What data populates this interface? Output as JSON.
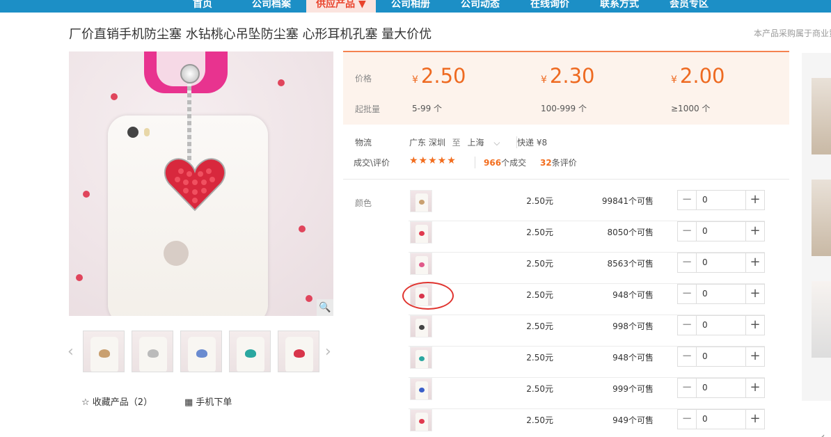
{
  "nav": {
    "items": [
      "首页",
      "公司档案",
      "供应产品 ▼",
      "公司相册",
      "公司动态",
      "在线询价",
      "联系方式",
      "会员专区"
    ]
  },
  "product": {
    "title": "厂价直销手机防尘塞 水钻桃心吊坠防尘塞 心形耳机孔塞 量大价优",
    "note": "本产品采购属于商业贸"
  },
  "prices": {
    "price_label": "价格",
    "moq_label": "起批量",
    "currency": "¥",
    "tiers": [
      {
        "price": "2.50",
        "range": "5-99 个"
      },
      {
        "price": "2.30",
        "range": "100-999 个"
      },
      {
        "price": "2.00",
        "range": "≥1000 个"
      }
    ]
  },
  "logistics": {
    "label": "物流",
    "from": "广东 深圳",
    "to_word": "至",
    "to": "上海",
    "method": "快递 ¥8"
  },
  "deals": {
    "label": "成交\\评价",
    "stars": "★★★★★",
    "deal_count": "966",
    "deal_unit": "个成交",
    "review_count": "32",
    "review_unit": "条评价"
  },
  "colors": {
    "label": "颜色",
    "rows": [
      {
        "price": "2.50元",
        "stock": "99841个可售",
        "qty": "0",
        "heart": "#c9a070"
      },
      {
        "price": "2.50元",
        "stock": "8050个可售",
        "qty": "0",
        "heart": "#e03a4f"
      },
      {
        "price": "2.50元",
        "stock": "8563个可售",
        "qty": "0",
        "heart": "#e05a8a"
      },
      {
        "price": "2.50元",
        "stock": "948个可售",
        "qty": "0",
        "heart": "#d8354b"
      },
      {
        "price": "2.50元",
        "stock": "998个可售",
        "qty": "0",
        "heart": "#444444"
      },
      {
        "price": "2.50元",
        "stock": "948个可售",
        "qty": "0",
        "heart": "#2aa7a0"
      },
      {
        "price": "2.50元",
        "stock": "999个可售",
        "qty": "0",
        "heart": "#3a5fc9"
      },
      {
        "price": "2.50元",
        "stock": "949个可售",
        "qty": "0",
        "heart": "#e03a4f"
      }
    ]
  },
  "actions": {
    "favorite": "收藏产品（2）",
    "mobile_order": "手机下单"
  }
}
